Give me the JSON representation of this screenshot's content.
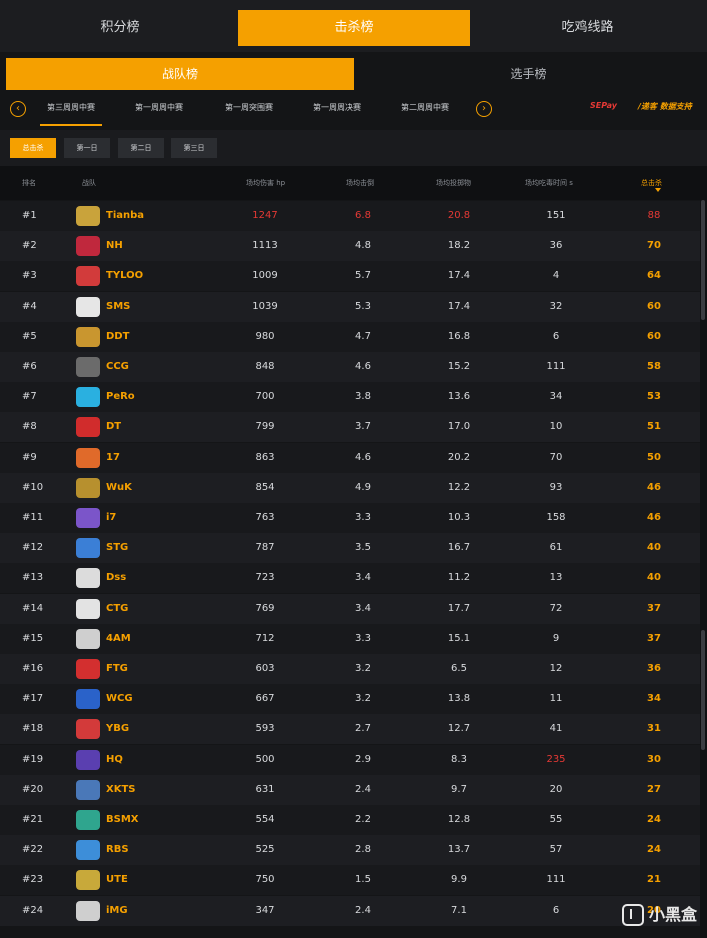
{
  "top_tabs": [
    {
      "label": "积分榜",
      "active": false
    },
    {
      "label": "击杀榜",
      "active": true
    },
    {
      "label": "吃鸡线路",
      "active": false
    }
  ],
  "sub_tabs": [
    {
      "label": "战队榜",
      "active": true
    },
    {
      "label": "选手榜",
      "active": false
    }
  ],
  "weeks": [
    "第三周周中赛",
    "第一周周中赛",
    "第一周突围赛",
    "第一周周决赛",
    "第二周周中赛"
  ],
  "sponsors": {
    "left": "SEPay",
    "right": "/递客 数据支持"
  },
  "days": [
    "总击杀",
    "第一日",
    "第二日",
    "第三日"
  ],
  "columns": [
    "排名",
    "战队",
    "场均伤害 hp",
    "场均击倒",
    "场均投掷物",
    "场均吃毒时间 s",
    "总击杀"
  ],
  "accent": "#f5a000",
  "rows": [
    {
      "rank": "#1",
      "team": "Tianba",
      "dmg": "1247",
      "kd": "6.8",
      "thr": "20.8",
      "poison": "151",
      "kills": "88",
      "logo": "#c9a33b",
      "red_dmg": true,
      "red_kd": true,
      "red_thr": true,
      "red_poison": false
    },
    {
      "rank": "#2",
      "team": "NH",
      "dmg": "1113",
      "kd": "4.8",
      "thr": "18.2",
      "poison": "36",
      "kills": "70",
      "logo": "#c0283d"
    },
    {
      "rank": "#3",
      "team": "TYLOO",
      "dmg": "1009",
      "kd": "5.7",
      "thr": "17.4",
      "poison": "4",
      "kills": "64",
      "logo": "#d23b3b"
    },
    {
      "rank": "#4",
      "team": "SMS",
      "dmg": "1039",
      "kd": "5.3",
      "thr": "17.4",
      "poison": "32",
      "kills": "60",
      "logo": "#e6e6e6"
    },
    {
      "rank": "#5",
      "team": "DDT",
      "dmg": "980",
      "kd": "4.7",
      "thr": "16.8",
      "poison": "6",
      "kills": "60",
      "logo": "#c9962f"
    },
    {
      "rank": "#6",
      "team": "CCG",
      "dmg": "848",
      "kd": "4.6",
      "thr": "15.2",
      "poison": "111",
      "kills": "58",
      "logo": "#6b6b6b"
    },
    {
      "rank": "#7",
      "team": "PeRo",
      "dmg": "700",
      "kd": "3.8",
      "thr": "13.6",
      "poison": "34",
      "kills": "53",
      "logo": "#2ab0e0"
    },
    {
      "rank": "#8",
      "team": "DT",
      "dmg": "799",
      "kd": "3.7",
      "thr": "17.0",
      "poison": "10",
      "kills": "51",
      "logo": "#d12c2c"
    },
    {
      "rank": "#9",
      "team": "17",
      "dmg": "863",
      "kd": "4.6",
      "thr": "20.2",
      "poison": "70",
      "kills": "50",
      "logo": "#e06a2a"
    },
    {
      "rank": "#10",
      "team": "WuK",
      "dmg": "854",
      "kd": "4.9",
      "thr": "12.2",
      "poison": "93",
      "kills": "46",
      "logo": "#b7902e"
    },
    {
      "rank": "#11",
      "team": "i7",
      "dmg": "763",
      "kd": "3.3",
      "thr": "10.3",
      "poison": "158",
      "kills": "46",
      "logo": "#7b55c9"
    },
    {
      "rank": "#12",
      "team": "STG",
      "dmg": "787",
      "kd": "3.5",
      "thr": "16.7",
      "poison": "61",
      "kills": "40",
      "logo": "#3b7fd6"
    },
    {
      "rank": "#13",
      "team": "Dss",
      "dmg": "723",
      "kd": "3.4",
      "thr": "11.2",
      "poison": "13",
      "kills": "40",
      "logo": "#dcdcdc"
    },
    {
      "rank": "#14",
      "team": "CTG",
      "dmg": "769",
      "kd": "3.4",
      "thr": "17.7",
      "poison": "72",
      "kills": "37",
      "logo": "#e3e3e3"
    },
    {
      "rank": "#15",
      "team": "4AM",
      "dmg": "712",
      "kd": "3.3",
      "thr": "15.1",
      "poison": "9",
      "kills": "37",
      "logo": "#cfcfcf"
    },
    {
      "rank": "#16",
      "team": "FTG",
      "dmg": "603",
      "kd": "3.2",
      "thr": "6.5",
      "poison": "12",
      "kills": "36",
      "logo": "#d32f2f"
    },
    {
      "rank": "#17",
      "team": "WCG",
      "dmg": "667",
      "kd": "3.2",
      "thr": "13.8",
      "poison": "11",
      "kills": "34",
      "logo": "#2a62c9"
    },
    {
      "rank": "#18",
      "team": "YBG",
      "dmg": "593",
      "kd": "2.7",
      "thr": "12.7",
      "poison": "41",
      "kills": "31",
      "logo": "#d33a3a"
    },
    {
      "rank": "#19",
      "team": "HQ",
      "dmg": "500",
      "kd": "2.9",
      "thr": "8.3",
      "poison": "235",
      "kills": "30",
      "logo": "#5a3fb0",
      "red_poison": true
    },
    {
      "rank": "#20",
      "team": "XKTS",
      "dmg": "631",
      "kd": "2.4",
      "thr": "9.7",
      "poison": "20",
      "kills": "27",
      "logo": "#4a78b8"
    },
    {
      "rank": "#21",
      "team": "BSMX",
      "dmg": "554",
      "kd": "2.2",
      "thr": "12.8",
      "poison": "55",
      "kills": "24",
      "logo": "#2fa58e"
    },
    {
      "rank": "#22",
      "team": "RBS",
      "dmg": "525",
      "kd": "2.8",
      "thr": "13.7",
      "poison": "57",
      "kills": "24",
      "logo": "#3d8ed9"
    },
    {
      "rank": "#23",
      "team": "UTE",
      "dmg": "750",
      "kd": "1.5",
      "thr": "9.9",
      "poison": "111",
      "kills": "21",
      "logo": "#c8a93a"
    },
    {
      "rank": "#24",
      "team": "iMG",
      "dmg": "347",
      "kd": "2.4",
      "thr": "7.1",
      "poison": "6",
      "kills": "20",
      "logo": "#cfcfcf"
    }
  ],
  "watermark": "小黑盒"
}
